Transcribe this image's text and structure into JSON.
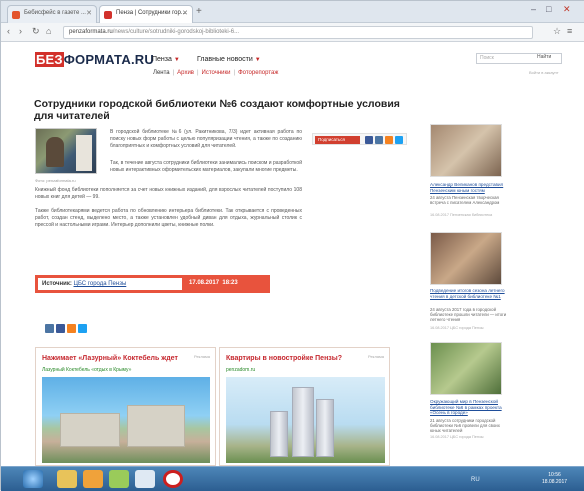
{
  "browser": {
    "tabs": [
      {
        "label": "Бебисфейс в газете ...",
        "favicon_color": "#e3542c"
      },
      {
        "label": "Пенза | Сотрудники гор...",
        "favicon_color": "#d2312b"
      }
    ],
    "new_tab": "+",
    "window_controls": [
      "–",
      "□",
      "✕"
    ],
    "url_host": "penzaformata.ru",
    "url_path": "/news/culture/sotrudniki-gorodskoj-biblioteki-6..."
  },
  "site": {
    "logo_prefix": "БЕЗ",
    "logo_rest": "ФОРМАТА.RU",
    "city_label": "Пенза",
    "main_news_label": "Главные новости",
    "sub_links": [
      "Лента",
      "Архив",
      "Источники",
      "Фоторепортаж"
    ],
    "search_placeholder": "Поиск",
    "search_button": "Найти",
    "top_right_note": "Войти в аккаунт"
  },
  "article": {
    "title": "Сотрудники городской библиотеки №6 создают комфортные условия для читателей",
    "photo_caption": "Фото: penzaformata.ru",
    "lead": "В городской библиотеке №6 (ул. Ракитникова, 7/3) идет активная работа по поиску новых форм работы с целью популяризации чтения, а также по созданию благоприятных и комфортных условий для читателей.",
    "body1": "Так, в течение августа сотрудники библиотеки занимались поиском и разработкой новых интерактивных оформительских материалов, закупали многие предметы.",
    "body2": "Книжный фонд библиотеки пополняется за счет новых книжных изданий, для взрослых читателей поступило 108 новых книг для детей — 99.",
    "body3": "Также библиотекарями ведется работа по обновлению интерьера библиотеки. Так открывается с проведенных работ, создан стенд, выделено место, а также установлен удобный диван для отдыха, журнальный столик с прессой и настольными играми. Интерьер дополнили цветы, книжные полки.",
    "share_label": "Подписаться",
    "source_label": "Источник:",
    "source_name": "ЦБС города Пензы",
    "date": "17.08.2017",
    "time": "18:23"
  },
  "promos": [
    {
      "title": "Нажимает «Лазурный» Коктебель ждет",
      "link": "Лазурный Коктебель «отдых в Крыму»",
      "ad": "Реклама"
    },
    {
      "title": "Квартиры в новостройке Пензы?",
      "link": "penzadom.ru",
      "ad": "Реклама"
    }
  ],
  "sidebar": [
    {
      "link": "Александр Великанов представил Пензенским юным гостям",
      "text": "24 августа Пензенская творческая встреча с писателем Александром",
      "date": "16.08.2017 Пензенская библиотека"
    },
    {
      "link": "Подведение итогов сезона летнего чтения в детской библиотеке №1",
      "text": "24 августа 2017 года в городской библиотеке прошли читатели — итоги летнего чтения",
      "date": "16.08.2017 ЦБС города Пензы"
    },
    {
      "link": "Окружающий мир в Пензенской библиотеке №6 в рамках проекта «Осень в городе»",
      "text": "21 августа сотрудники городской библиотеки №6 провели для своих юных читателей",
      "date": "16.08.2017 ЦБС города Пензы"
    }
  ],
  "taskbar": {
    "clock_time": "10:56",
    "clock_date": "18.08.2017",
    "tray_lang": "RU"
  },
  "colors": {
    "accent_red": "#d2312b",
    "source_bar": "#e8533d",
    "link_blue": "#1f4e9a"
  }
}
